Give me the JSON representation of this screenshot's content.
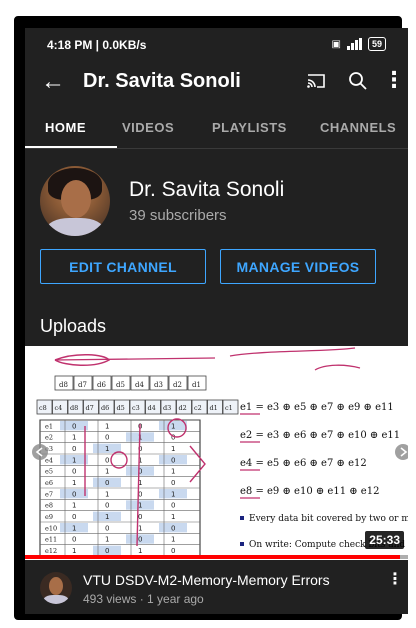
{
  "status_bar": {
    "time": "4:18 PM | 0.0KB/s",
    "battery": "59"
  },
  "app_bar": {
    "title": "Dr. Savita Sonoli"
  },
  "tabs": [
    {
      "label": "HOME"
    },
    {
      "label": "VIDEOS"
    },
    {
      "label": "PLAYLISTS"
    },
    {
      "label": "CHANNELS"
    }
  ],
  "channel": {
    "name": "Dr. Savita Sonoli",
    "subscribers": "39 subscribers"
  },
  "buttons": {
    "edit": "EDIT CHANNEL",
    "manage": "MANAGE VIDEOS"
  },
  "section": {
    "title": "Uploads"
  },
  "video": {
    "duration": "25:33",
    "progress": 0.98,
    "title": "VTU DSDV-M2-Memory-Memory Errors",
    "meta": "493 views · 1 year ago",
    "slide": {
      "header_bits": [
        "d8",
        "d7",
        "d6",
        "d5",
        "d4",
        "d3",
        "d2",
        "d1"
      ],
      "bits_row": [
        "c8",
        "c4",
        "d8",
        "d7",
        "d6",
        "d5",
        "c3",
        "d4",
        "d3",
        "d2",
        "c2",
        "d1",
        "c1"
      ],
      "equations": [
        "e1 = e3 ⊕ e5 ⊕ e7 ⊕ e9 ⊕ e11",
        "e2 = e3 ⊕ e6 ⊕ e7 ⊕ e10 ⊕ e11",
        "e4 = e5 ⊕ e6 ⊕ e7 ⊕ e12",
        "e8 = e9 ⊕ e10 ⊕ e11 ⊕ e12"
      ],
      "bullets": [
        "Every data bit covered by two or more check bits",
        "On write: Compute check bits and"
      ],
      "table_labels": [
        "e1",
        "e2",
        "e3",
        "e4",
        "e5",
        "e6",
        "e7",
        "e8",
        "e9",
        "e10",
        "e11",
        "e12"
      ]
    }
  },
  "colors": {
    "accent": "#3ea6ff",
    "background": "#212121",
    "progress": "#ff0000"
  }
}
